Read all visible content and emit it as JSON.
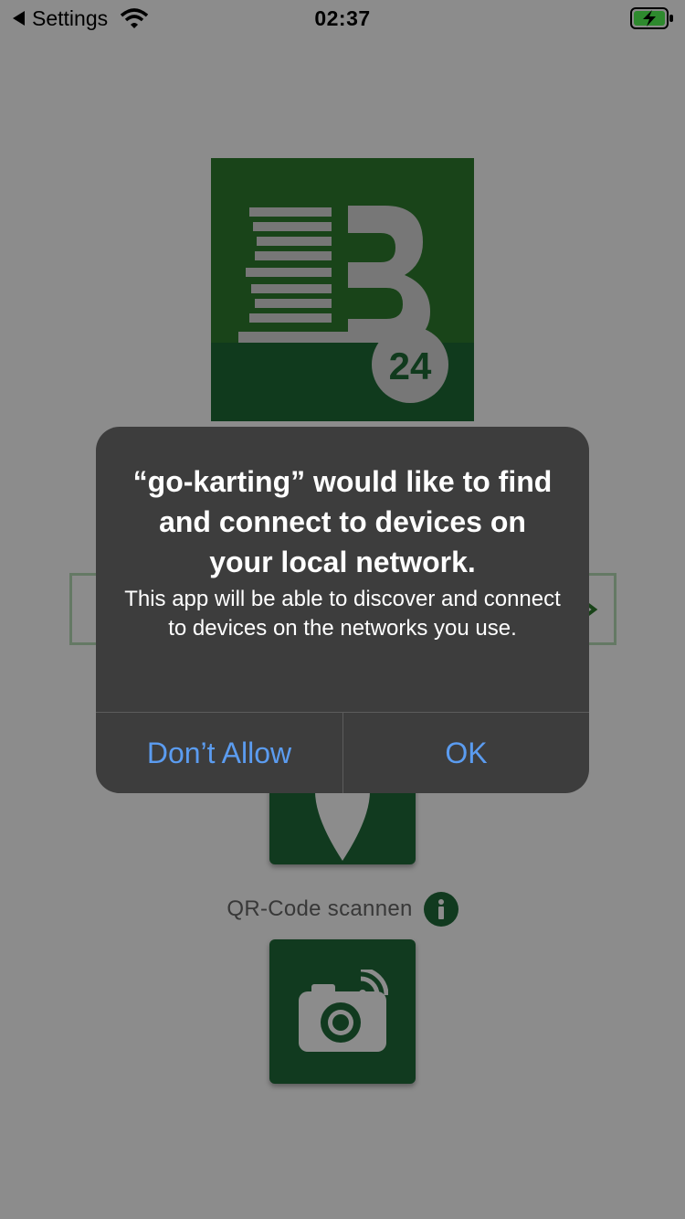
{
  "status_bar": {
    "back_label": "Settings",
    "time": "02:37",
    "battery": "charging"
  },
  "app": {
    "logo_text": "24",
    "input_placeholder": "",
    "qr_label": "QR-Code scannen",
    "colors": {
      "brand_green": "#2f7d2f",
      "button_green": "#1f6b3a",
      "input_border": "#b7dcb7"
    }
  },
  "alert": {
    "title": "“go-karting” would like to find and connect to devices on your local network.",
    "message": "This app will be able to discover and connect to devices on the networks you use.",
    "buttons": {
      "deny": "Don’t Allow",
      "ok": "OK"
    },
    "colors": {
      "background": "#3d3d3d",
      "button_text": "#5b9cf0"
    }
  },
  "icons": {
    "back": "back-arrow-icon",
    "wifi": "wifi-icon",
    "battery": "battery-charging-icon",
    "logo": "b24-logo",
    "go": "arrow-right-icon",
    "pin": "map-pin-icon",
    "info": "info-icon",
    "camera": "camera-wireless-icon"
  }
}
